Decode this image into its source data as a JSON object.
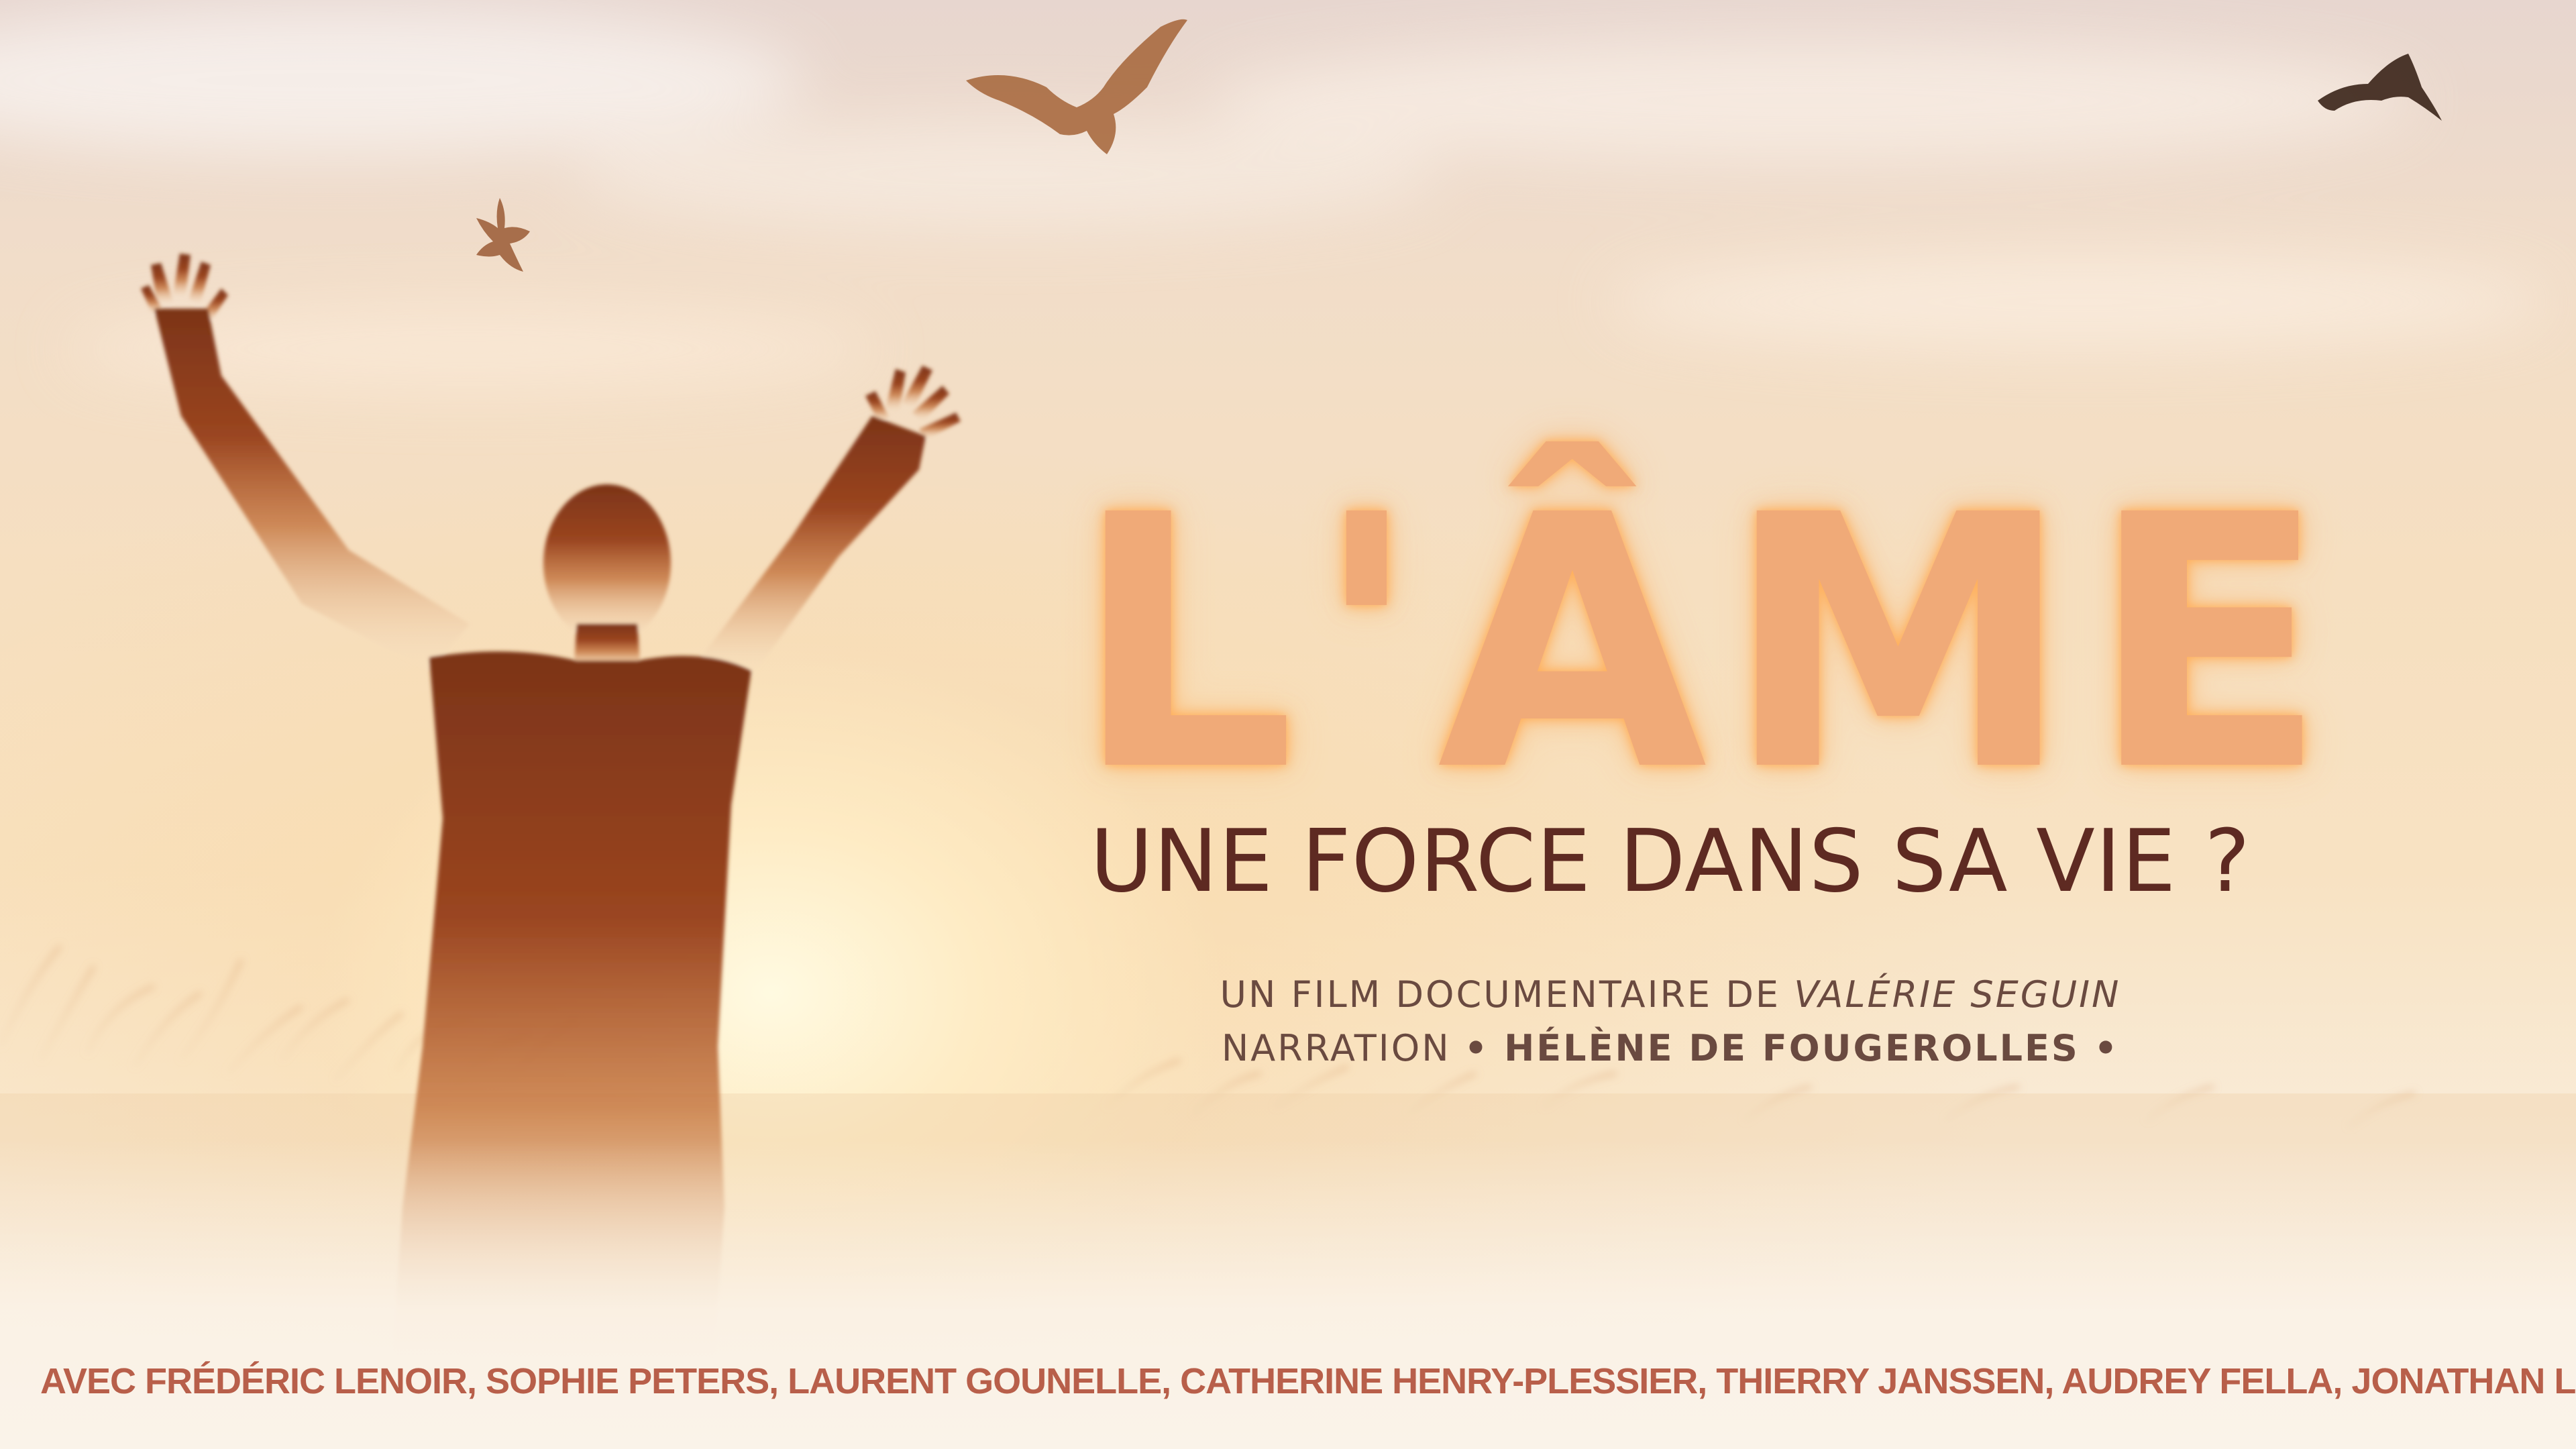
{
  "poster": {
    "title": "L'ÂME",
    "subtitle": "UNE FORCE DANS SA VIE ?",
    "credit_prefix": "UN FILM DOCUMENTAIRE DE",
    "director": "VALÉRIE SEGUIN",
    "narration_label": "NARRATION",
    "narrator": "• HÉLÈNE DE FOUGEROLLES •",
    "cast": "AVEC FRÉDÉRIC LENOIR, SOPHIE PETERS, LAURENT GOUNELLE, CATHERINE HENRY-PLESSIER, THIERRY JANSSEN, AUDREY FELLA, JONATHAN LEHMANN, AGNÈS STÉVENIN, ARMELLE SIX, ..."
  },
  "colors": {
    "title": "#f0aa78",
    "subtitle": "#5e2a22",
    "credits": "#6a4a40",
    "cast": "#b85f4a",
    "silhouette": "#8e3a1e"
  }
}
